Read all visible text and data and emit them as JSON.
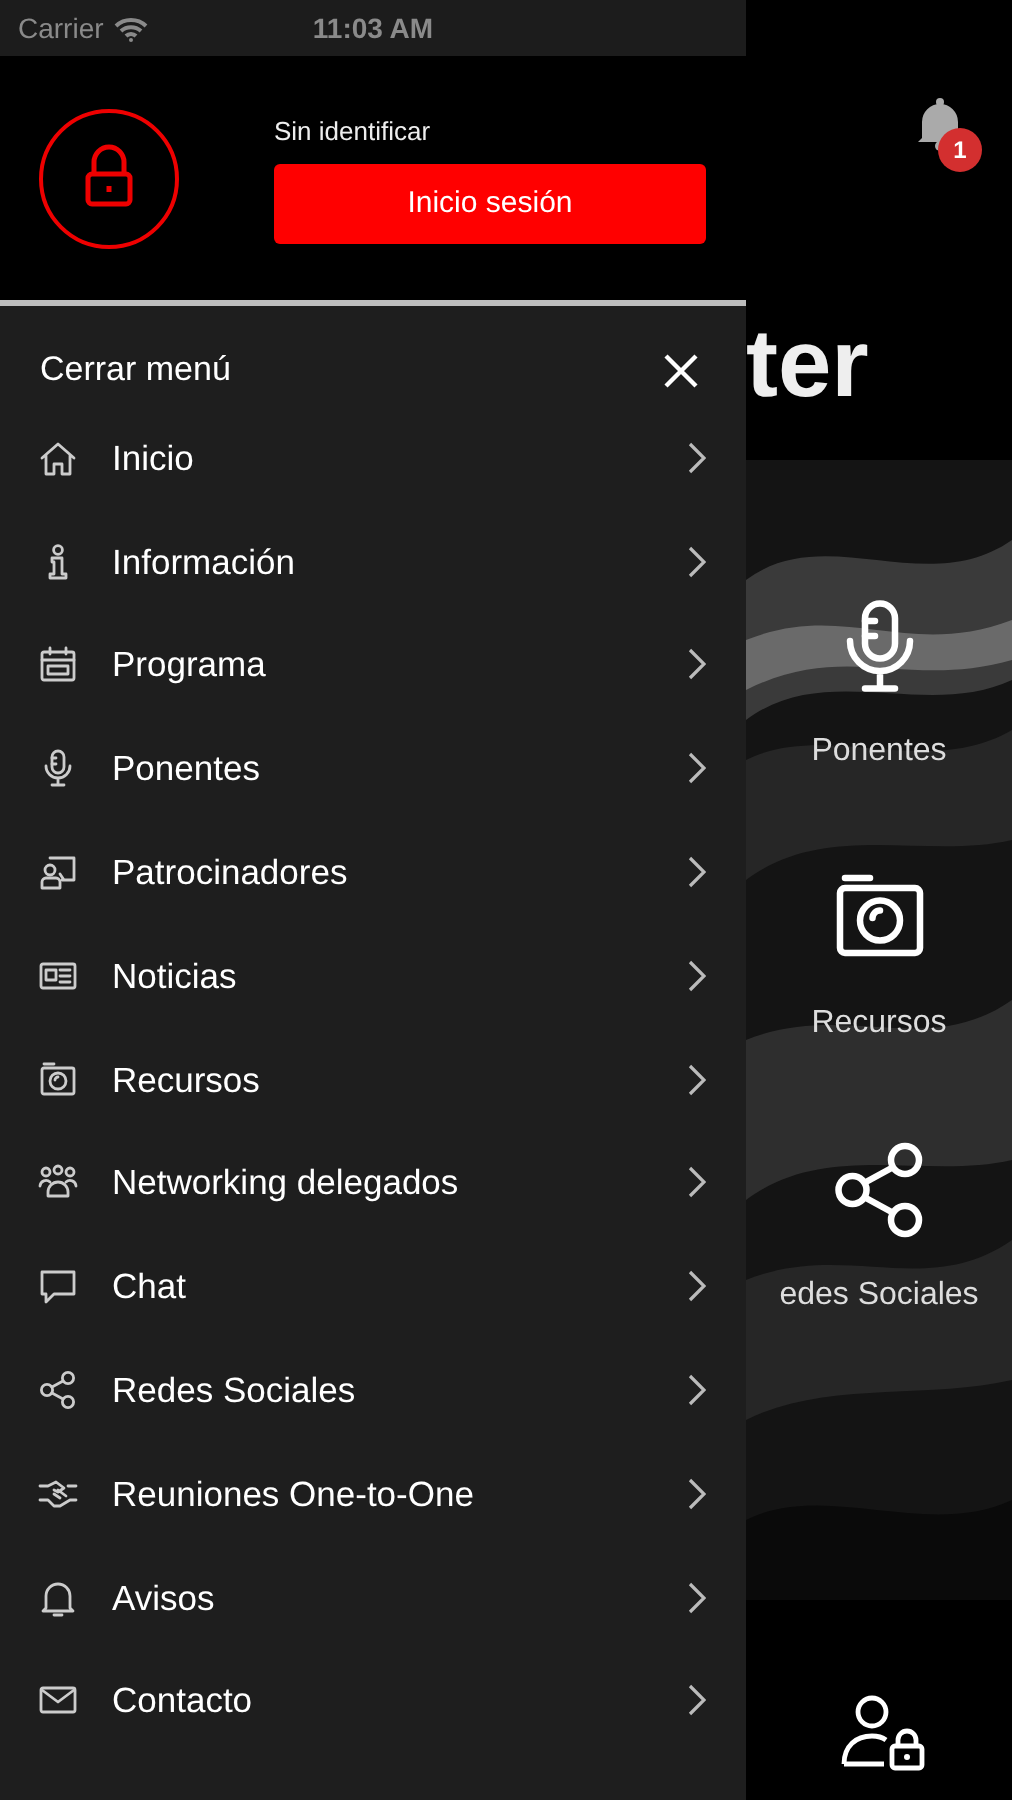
{
  "status_bar": {
    "carrier": "Carrier",
    "time": "11:03 AM"
  },
  "account": {
    "status": "Sin identificar",
    "login_button": "Inicio sesión"
  },
  "drawer": {
    "close_label": "Cerrar menú",
    "items": [
      {
        "label": "Inicio",
        "kind": "home"
      },
      {
        "label": "Información",
        "kind": "info"
      },
      {
        "label": "Programa",
        "kind": "calendar"
      },
      {
        "label": "Ponentes",
        "kind": "mic"
      },
      {
        "label": "Patrocinadores",
        "kind": "sponsor"
      },
      {
        "label": "Noticias",
        "kind": "news"
      },
      {
        "label": "Recursos",
        "kind": "camera"
      },
      {
        "label": "Networking delegados",
        "kind": "people"
      },
      {
        "label": "Chat",
        "kind": "chat"
      },
      {
        "label": "Redes Sociales",
        "kind": "share"
      },
      {
        "label": "Reuniones One-to-One",
        "kind": "handshake"
      },
      {
        "label": "Avisos",
        "kind": "bell"
      },
      {
        "label": "Contacto",
        "kind": "mail"
      }
    ]
  },
  "background": {
    "title_fragment": "ter",
    "notification_count": "1",
    "tiles": [
      {
        "label": "Ponentes",
        "kind": "mic"
      },
      {
        "label": "Recursos",
        "kind": "camera"
      },
      {
        "label": "edes Sociales",
        "kind": "share"
      }
    ]
  }
}
